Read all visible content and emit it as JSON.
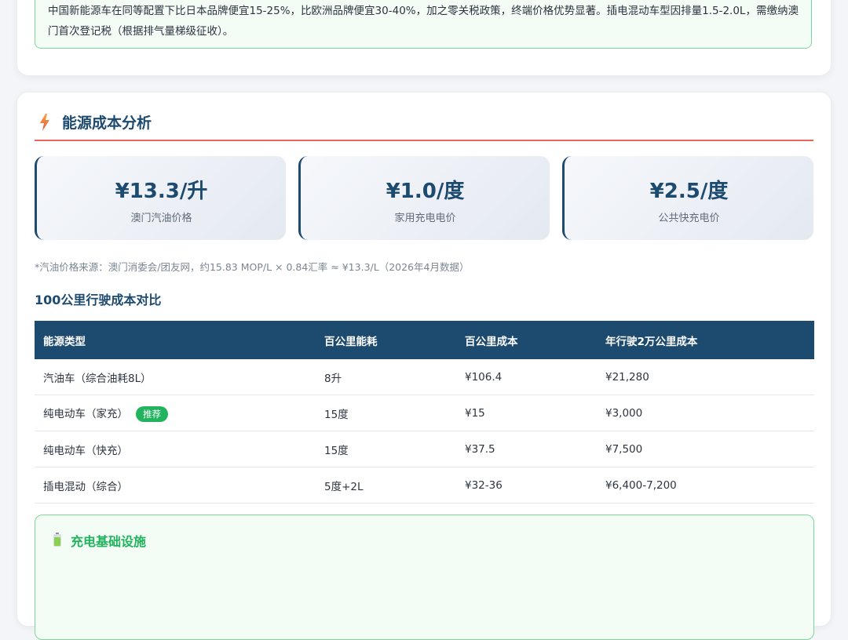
{
  "top_note": {
    "text": "中国新能源车在同等配置下比日本品牌便宜15-25%，比欧洲品牌便宜30-40%，加之零关税政策，终端价格优势显著。插电混动车型因排量1.5-2.0L，需缴纳澳门首次登记税（根据排气量梯级征收）。"
  },
  "energy_section": {
    "title": "能源成本分析",
    "icon": "lightning-icon",
    "accent_color": "#e5675b",
    "prices": [
      {
        "value": "¥13.3/升",
        "label": "澳门汽油价格"
      },
      {
        "value": "¥1.0/度",
        "label": "家用充电电价"
      },
      {
        "value": "¥2.5/度",
        "label": "公共快充电价"
      }
    ],
    "footnote": "*汽油价格来源：澳门消委会/团友网，约15.83 MOP/L × 0.84汇率 ≈ ¥13.3/L（2026年4月数据）",
    "table_title": "100公里行驶成本对比",
    "table": {
      "headers": [
        "能源类型",
        "百公里能耗",
        "百公里成本",
        "年行驶2万公里成本"
      ],
      "rows": [
        {
          "type": "汽油车（综合油耗8L）",
          "consumption": "8升",
          "cost_100km": "¥106.4",
          "annual": "¥21,280",
          "badge": ""
        },
        {
          "type": "纯电动车（家充）",
          "consumption": "15度",
          "cost_100km": "¥15",
          "annual": "¥3,000",
          "badge": "推荐"
        },
        {
          "type": "纯电动车（快充）",
          "consumption": "15度",
          "cost_100km": "¥37.5",
          "annual": "¥7,500",
          "badge": ""
        },
        {
          "type": "插电混动（综合）",
          "consumption": "5度+2L",
          "cost_100km": "¥32-36",
          "annual": "¥6,400-7,200",
          "badge": ""
        }
      ]
    }
  },
  "infrastructure": {
    "title": "充电基础设施",
    "icon": "battery-icon",
    "color": "#22b35e"
  }
}
